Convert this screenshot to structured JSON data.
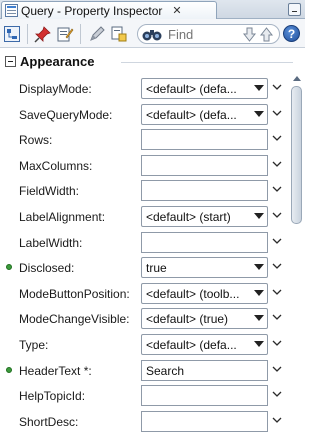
{
  "window": {
    "title": "Query - Property Inspector",
    "close_glyph": "✕"
  },
  "toolbar": {
    "search_placeholder": "Find",
    "help_label": "?"
  },
  "section": {
    "title": "Appearance",
    "state": "expanded"
  },
  "properties": [
    {
      "label": "DisplayMode:",
      "type": "combo",
      "value": "<default> (defa...",
      "marker": false
    },
    {
      "label": "SaveQueryMode:",
      "type": "combo",
      "value": "<default> (defa...",
      "marker": false
    },
    {
      "label": "Rows:",
      "type": "text",
      "value": "",
      "marker": false
    },
    {
      "label": "MaxColumns:",
      "type": "text",
      "value": "",
      "marker": false
    },
    {
      "label": "FieldWidth:",
      "type": "text",
      "value": "",
      "marker": false
    },
    {
      "label": "LabelAlignment:",
      "type": "combo",
      "value": "<default> (start)",
      "marker": false
    },
    {
      "label": "LabelWidth:",
      "type": "text",
      "value": "",
      "marker": false
    },
    {
      "label": "Disclosed:",
      "type": "combo",
      "value": "true",
      "marker": true
    },
    {
      "label": "ModeButtonPosition:",
      "type": "combo",
      "value": "<default> (toolb...",
      "marker": false
    },
    {
      "label": "ModeChangeVisible:",
      "type": "combo",
      "value": "<default> (true)",
      "marker": false
    },
    {
      "label": "Type:",
      "type": "combo",
      "value": "<default> (defa...",
      "marker": false
    },
    {
      "label": "HeaderText *:",
      "type": "text",
      "value": "Search",
      "marker": true
    },
    {
      "label": "HelpTopicId:",
      "type": "text",
      "value": "",
      "marker": false
    },
    {
      "label": "ShortDesc:",
      "type": "text",
      "value": "",
      "marker": false
    }
  ],
  "colors": {
    "accent": "#1f4f9c",
    "set_marker": "#3c9a3c"
  }
}
